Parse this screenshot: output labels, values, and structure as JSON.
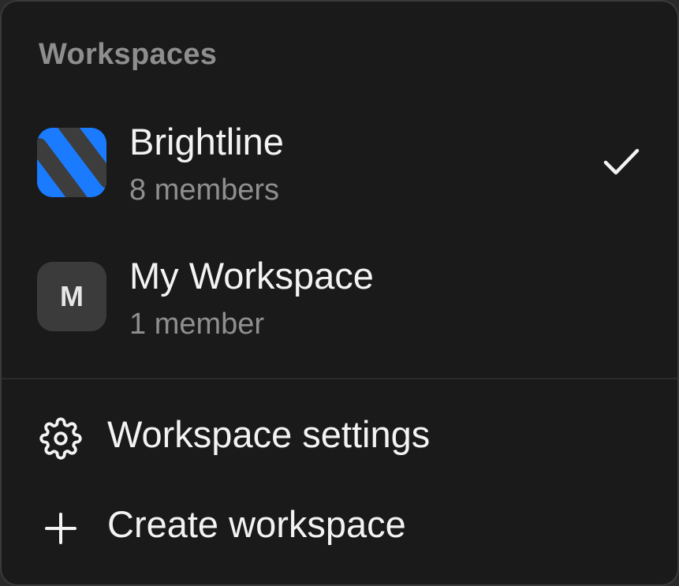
{
  "header": {
    "title": "Workspaces"
  },
  "workspaces": [
    {
      "name": "Brightline",
      "members": "8 members",
      "icon": "brightline-logo-icon",
      "selected": true,
      "brand_color": "#1a7bff"
    },
    {
      "name": "My Workspace",
      "members": "1 member",
      "initial": "M",
      "icon": "letter-avatar",
      "selected": false
    }
  ],
  "actions": [
    {
      "label": "Workspace settings",
      "icon": "gear-icon"
    },
    {
      "label": "Create workspace",
      "icon": "plus-icon"
    }
  ],
  "colors": {
    "background": "#1a1a1a",
    "text_primary": "#f3f3f3",
    "text_secondary": "#8f8f8f",
    "accent": "#1a7bff"
  }
}
